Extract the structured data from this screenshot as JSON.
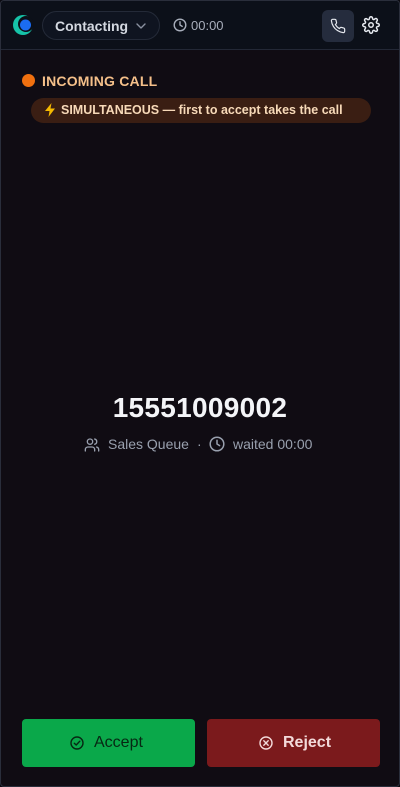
{
  "header": {
    "status_value": "Contacting",
    "timer": "00:00",
    "icons": [
      "logo-icon",
      "chevron-down-icon",
      "clock-icon",
      "phone-icon",
      "gear-icon"
    ]
  },
  "incoming": {
    "label": "INCOMING CALL",
    "indicator_color": "#f0700f",
    "mode_badge": "SIMULTANEOUS — first to accept takes the call",
    "mode_icon": "lightning-bolt-icon"
  },
  "caller": {
    "number": "15551009002",
    "queue": "Sales Queue",
    "separator": "·",
    "waited": "waited 00:00"
  },
  "actions": {
    "accept_label": "Accept",
    "accept_color": "#0aa84a",
    "reject_label": "Reject",
    "reject_color": "#7b1a1c"
  }
}
